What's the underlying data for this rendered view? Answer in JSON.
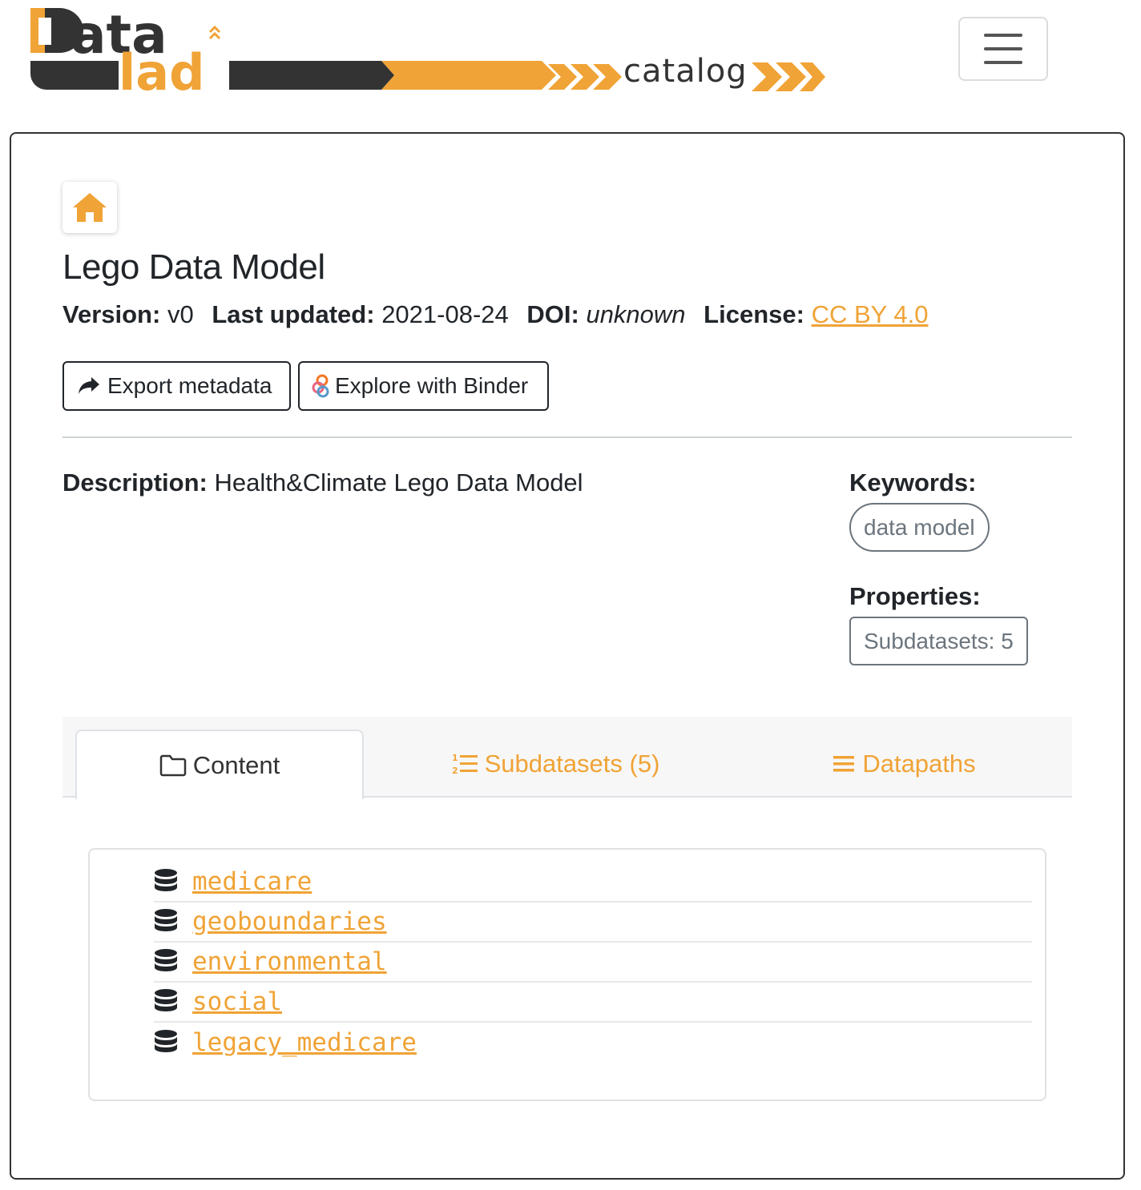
{
  "header": {
    "logo_word": "catalog",
    "menu_icon": "hamburger-menu-icon"
  },
  "dataset": {
    "title": "Lego Data Model",
    "version_label": "Version:",
    "version": "v0",
    "updated_label": "Last updated:",
    "updated": "2021-08-24",
    "doi_label": "DOI:",
    "doi": "unknown",
    "license_label": "License:",
    "license": "CC BY 4.0"
  },
  "actions": {
    "export_label": "Export metadata",
    "binder_label": "Explore with Binder"
  },
  "description": {
    "label": "Description:",
    "text": "Health&Climate Lego Data Model"
  },
  "keywords": {
    "label": "Keywords:",
    "items": [
      "data model"
    ]
  },
  "properties": {
    "label": "Properties:",
    "subdatasets": "Subdatasets: 5"
  },
  "tabs": [
    {
      "label": "Content",
      "icon": "folder-icon",
      "active": true
    },
    {
      "label": "Subdatasets (5)",
      "icon": "ordered-list-icon",
      "active": false
    },
    {
      "label": "Datapaths",
      "icon": "list-icon",
      "active": false
    }
  ],
  "content_items": [
    "medicare",
    "geoboundaries",
    "environmental",
    "social",
    "legacy_medicare"
  ],
  "colors": {
    "accent": "#f0a336",
    "dark": "#333333"
  }
}
